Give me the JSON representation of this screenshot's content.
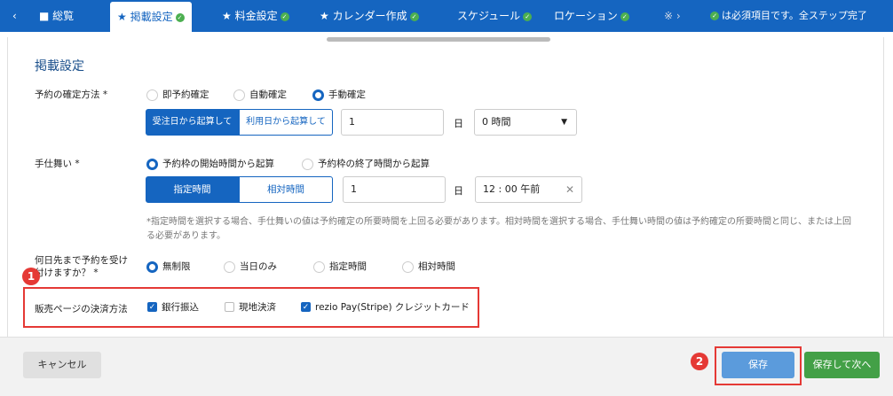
{
  "tabs": {
    "back": "‹",
    "overview": "総覧",
    "publish": "★ 掲載設定",
    "price": "★ 料金設定",
    "calendar": "★ カレンダー作成",
    "schedule": "スケジュール",
    "location": "ロケーション",
    "more": "※ ›",
    "required_note": "は必須項目です。全ステップ完了"
  },
  "form": {
    "title": "掲載設定",
    "confirm": {
      "label": "予約の確定方法 *",
      "options": [
        "即予約確定",
        "自動確定",
        "手動確定"
      ],
      "selected": "手動確定",
      "seg": [
        "受注日から起算して",
        "利用日から起算して"
      ],
      "value": "1",
      "unit": "日",
      "time": "0 時間"
    },
    "close": {
      "label": "手仕舞い *",
      "options": [
        "予約枠の開始時間から起算",
        "予約枠の終了時間から起算"
      ],
      "selected": "予約枠の開始時間から起算",
      "seg": [
        "指定時間",
        "相対時間"
      ],
      "value": "1",
      "unit": "日",
      "time": "12 : 00 午前",
      "note": "*指定時間を選択する場合、手仕舞いの値は予約確定の所要時間を上回る必要があります。相対時間を選択する場合、手仕舞い時間の値は予約確定の所要時間と同じ、または上回る必要があります。"
    },
    "advance": {
      "label_line1": "何日先まで予約を受け",
      "label_line2": "付けますか？ *",
      "options": [
        "無制限",
        "当日のみ",
        "指定時間",
        "相対時間"
      ],
      "selected": "無制限"
    },
    "payment": {
      "label": "販売ページの決済方法",
      "options": [
        {
          "label": "銀行振込",
          "checked": true
        },
        {
          "label": "現地決済",
          "checked": false
        },
        {
          "label": "rezio Pay(Stripe) クレジットカード",
          "checked": true
        }
      ]
    }
  },
  "annotations": {
    "one": "1",
    "two": "2"
  },
  "footer": {
    "cancel": "キャンセル",
    "save": "保存",
    "save_next": "保存して次へ"
  },
  "colors": {
    "primary": "#1565c0",
    "success": "#43a047",
    "annotation": "#e53935"
  }
}
